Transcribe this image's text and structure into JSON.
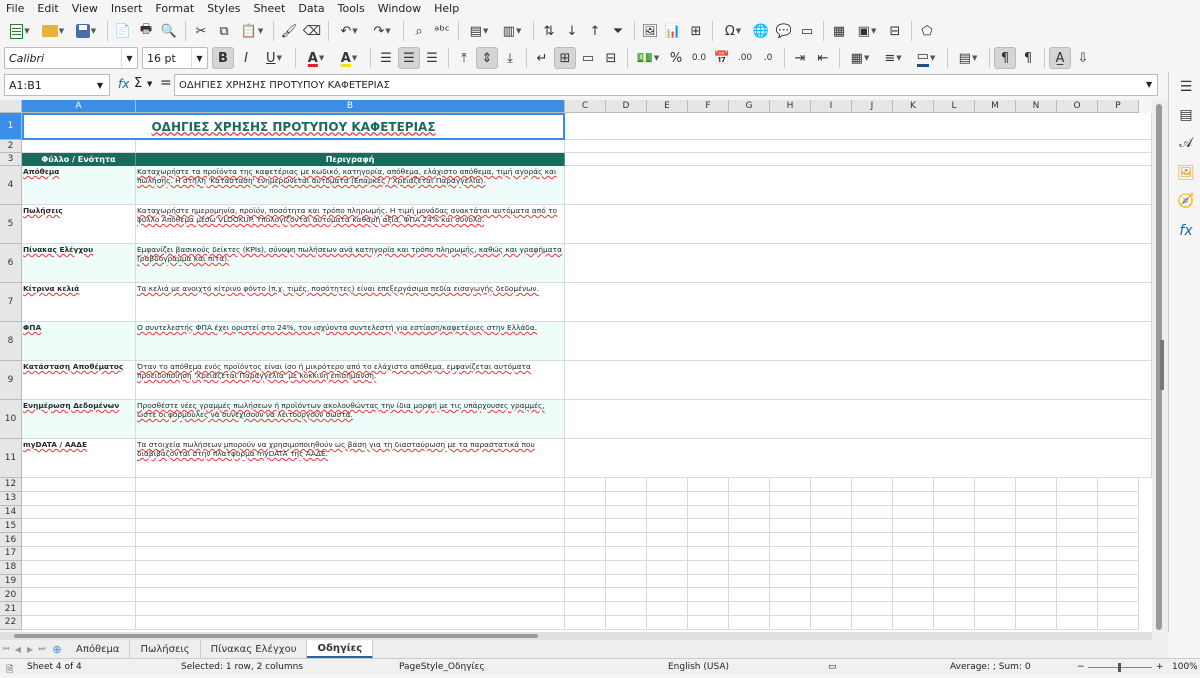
{
  "menu": [
    "File",
    "Edit",
    "View",
    "Insert",
    "Format",
    "Styles",
    "Sheet",
    "Data",
    "Tools",
    "Window",
    "Help"
  ],
  "toolbar": {
    "font_name": "Calibri",
    "font_size": "16 pt",
    "bold": "B",
    "italic": "I",
    "underline": "U",
    "font_color": "A",
    "highlight": "A",
    "percent": "%",
    "number_format": "0.0",
    "add_decimal": ".00",
    "delete_decimal": ".0",
    "accent_color": "#1a6aa8"
  },
  "formula_bar": {
    "name_box": "A1:B1",
    "fx": "fx",
    "sigma": "Σ",
    "equals": "=",
    "content": "ΟΔΗΓΙΕΣ ΧΡΗΣΗΣ ΠΡΟΤΥΠΟΥ ΚΑΦΕΤΕΡΙΑΣ"
  },
  "columns": [
    "A",
    "B",
    "C",
    "D",
    "E",
    "F",
    "G",
    "H",
    "I",
    "J",
    "K",
    "L",
    "M",
    "N",
    "O",
    "P"
  ],
  "rows": [
    "1",
    "2",
    "3",
    "4",
    "5",
    "6",
    "7",
    "8",
    "9",
    "10",
    "11",
    "12",
    "13",
    "14",
    "15",
    "16",
    "17",
    "18",
    "19",
    "20",
    "21",
    "22"
  ],
  "sheet": {
    "title": "ΟΔΗΓΙΕΣ ΧΡΗΣΗΣ ΠΡΟΤΥΠΟΥ ΚΑΦΕΤΕΡΙΑΣ",
    "header": [
      "Φύλλο / Ενότητα",
      "Περιγραφή"
    ],
    "entries": [
      {
        "a": "Απόθεμα",
        "b": "Καταχωρήστε τα προϊόντα της καφετέριας με κωδικό, κατηγορία, απόθεμα, ελάχιστο απόθεμα, τιμή αγοράς και πώλησης. Η στήλη 'Κατάσταση' ενημερώνεται αυτόματα (Επαρκές / Χρειάζεται Παραγγελία)."
      },
      {
        "a": "Πωλήσεις",
        "b": "Καταχωρήστε ημερομηνία, προϊόν, ποσότητα και τρόπο πληρωμής. Η τιμή μονάδας ανακτάται αυτόματα από το φύλλο Απόθεμα μέσω VLOOKUP. Υπολογίζονται αυτόματα καθαρή αξία, ΦΠΑ 24% και σύνολο."
      },
      {
        "a": "Πίνακας Ελέγχου",
        "b": "Εμφανίζει βασικούς δείκτες (KPIs), σύνοψη πωλήσεων ανά κατηγορία και τρόπο πληρωμής, καθώς και γραφήματα (ραβδόγραμμα και πίτα)."
      },
      {
        "a": "Κίτρινα κελιά",
        "b": "Τα κελιά με ανοιχτό κίτρινο φόντο (π.χ. τιμές, ποσότητες) είναι επεξεργάσιμα πεδία εισαγωγής δεδομένων."
      },
      {
        "a": "ΦΠΑ",
        "b": "Ο συντελεστής ΦΠΑ έχει οριστεί στο 24%, τον ισχύοντα συντελεστή για εστίαση/καφετέριες στην Ελλάδα."
      },
      {
        "a": "Κατάσταση Αποθέματος",
        "b": "Όταν το απόθεμα ενός προϊόντος είναι ίσο ή μικρότερο από το ελάχιστο απόθεμα, εμφανίζεται αυτόματα προειδοποίηση 'Χρειάζεται Παραγγελία' με κόκκινη επισήμανση."
      },
      {
        "a": "Ενημέρωση Δεδομένων",
        "b": "Προσθέστε νέες γραμμές πωλήσεων ή προϊόντων ακολουθώντας την ίδια μορφή με τις υπάρχουσες γραμμές, ώστε οι φόρμουλες να συνεχίσουν να λειτουργούν σωστά."
      },
      {
        "a": "myDATA / ΑΑΔΕ",
        "b": "Τα στοιχεία πωλήσεων μπορούν να χρησιμοποιηθούν ως βάση για τη διασταύρωση με τα παραστατικά που διαβιβάζονται στην πλατφόρμα myDATA της ΑΑΔΕ."
      }
    ]
  },
  "tabs": [
    "Απόθεμα",
    "Πωλήσεις",
    "Πίνακας Ελέγχου",
    "Οδηγίες"
  ],
  "active_tab": "Οδηγίες",
  "status": {
    "sheet": "Sheet 4 of 4",
    "selection": "Selected: 1 row, 2 columns",
    "page_style": "PageStyle_Οδηγίες",
    "language": "English (USA)",
    "summary": "Average: ; Sum: 0",
    "zoom": "100%",
    "zoom_minus": "−",
    "zoom_plus": "+"
  },
  "colors": {
    "header_fill": "#1a6b5c",
    "row_tint": "#effdfa",
    "selection": "#3a8ee6"
  }
}
